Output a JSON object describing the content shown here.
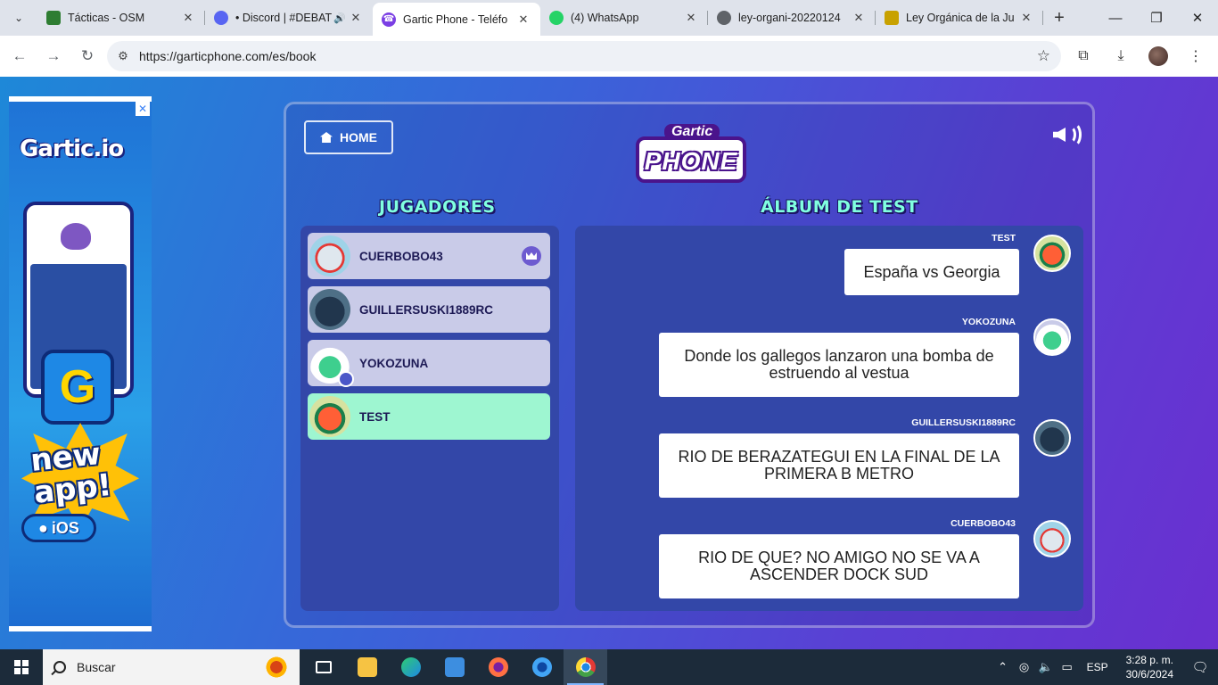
{
  "browser": {
    "tabs": [
      {
        "title": "Tácticas - OSM",
        "color": "#2e7d32",
        "active": false
      },
      {
        "title": "• Discord | #DEBAT",
        "color": "#5865f2",
        "active": false
      },
      {
        "title": "Gartic Phone - Teléfo",
        "color": "#7b3fe4",
        "active": true
      },
      {
        "title": "(4) WhatsApp",
        "color": "#25d366",
        "active": false
      },
      {
        "title": "ley-organi-20220124",
        "color": "#5f6368",
        "active": false
      },
      {
        "title": "Ley Orgánica de la Ju",
        "color": "#c8a100",
        "active": false
      }
    ],
    "url": "https://garticphone.com/es/book"
  },
  "ad": {
    "brand": "Gartic.io",
    "headline": "new app!",
    "platform": "iOS"
  },
  "game": {
    "home_label": "HOME",
    "logo_small": "Gartic",
    "logo_big": "PHONE",
    "players_title": "JUGADORES",
    "album_title": "ÁLBUM DE TEST",
    "players": [
      {
        "name": "CUERBOBO43",
        "avatar": "knight",
        "host": true
      },
      {
        "name": "GUILLERSUSKI1889RC",
        "avatar": "robot"
      },
      {
        "name": "YOKOZUNA",
        "avatar": "chef",
        "you": true
      },
      {
        "name": "TEST",
        "avatar": "mask",
        "current": true
      }
    ],
    "album": [
      {
        "author": "TEST",
        "text": "España vs Georgia",
        "avatar": "mask"
      },
      {
        "author": "YOKOZUNA",
        "text": "Donde los gallegos lanzaron una bomba de estruendo al vestua",
        "avatar": "chef"
      },
      {
        "author": "GUILLERSUSKI1889RC",
        "text": "RIO DE BERAZATEGUI EN LA FINAL DE LA PRIMERA B METRO",
        "avatar": "robot"
      },
      {
        "author": "CUERBOBO43",
        "text": "RIO DE QUE? NO AMIGO NO SE VA A ASCENDER DOCK SUD",
        "avatar": "knight"
      }
    ]
  },
  "taskbar": {
    "search_placeholder": "Buscar",
    "language": "ESP",
    "time": "3:28 p. m.",
    "date": "30/6/2024"
  }
}
